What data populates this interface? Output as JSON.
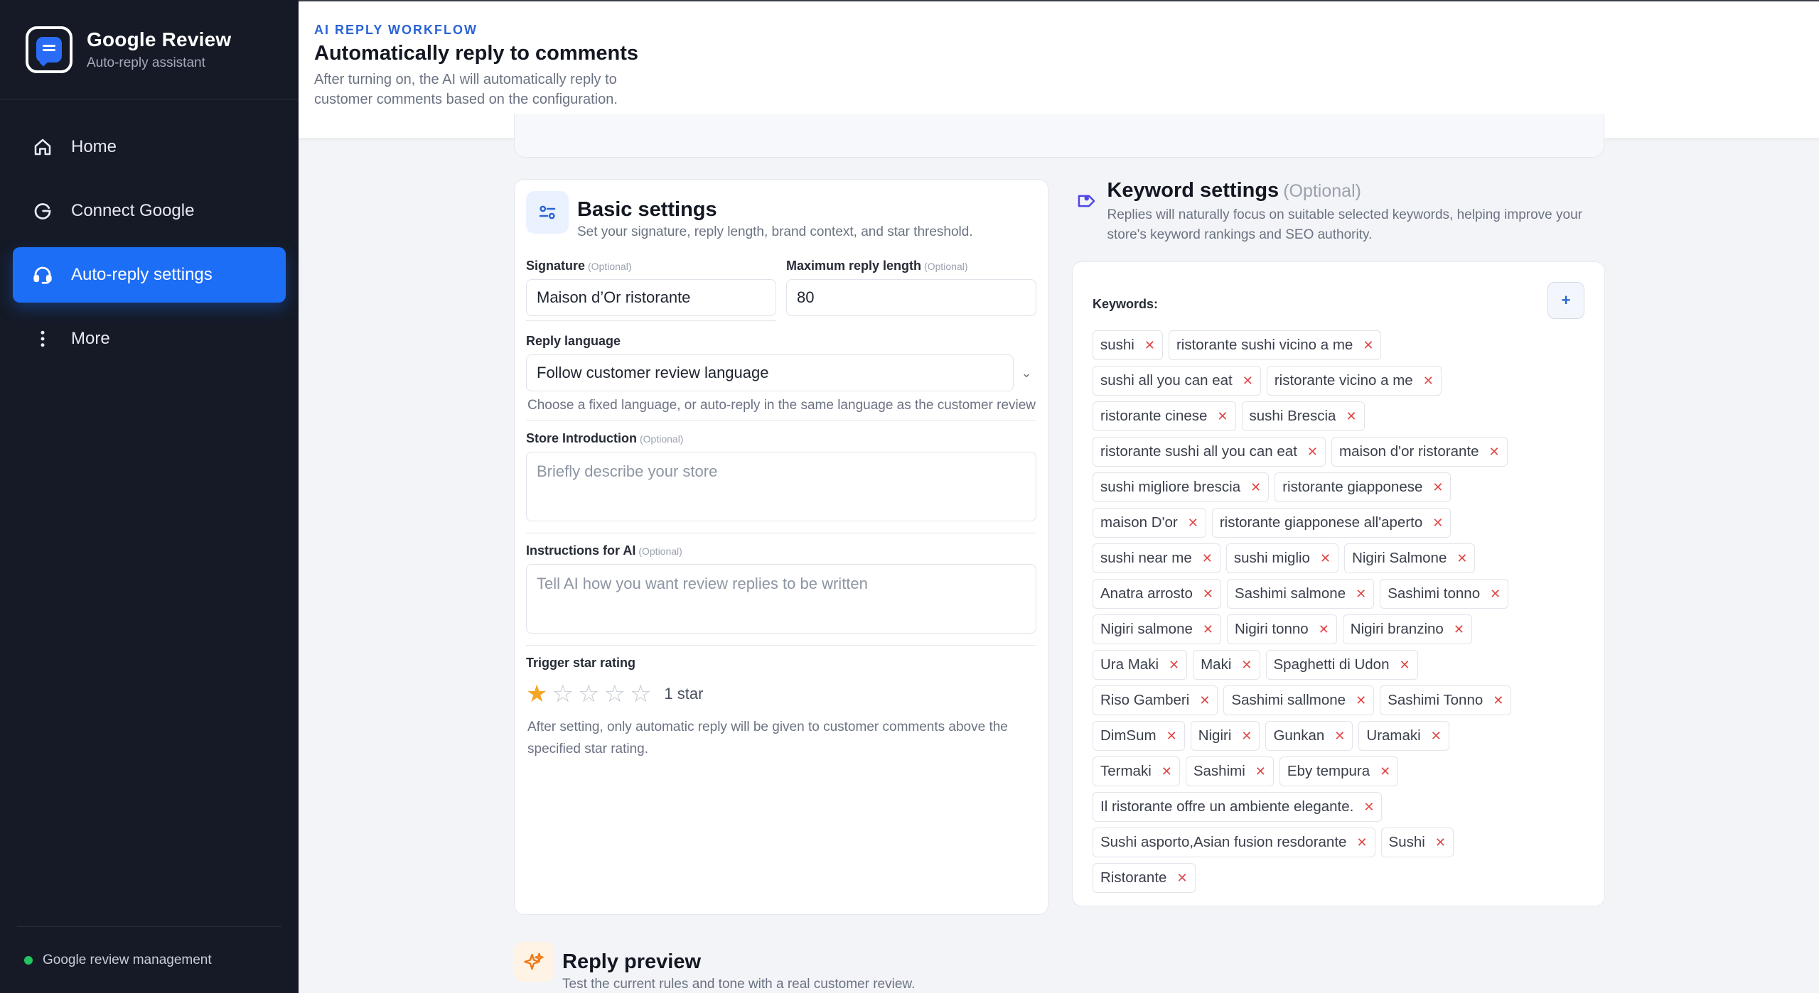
{
  "brand": {
    "title": "Google Review",
    "subtitle": "Auto-reply assistant"
  },
  "nav": [
    {
      "label": "Home",
      "icon": "home-icon"
    },
    {
      "label": "Connect Google",
      "icon": "google-g-icon"
    },
    {
      "label": "Auto-reply settings",
      "icon": "headset-icon",
      "active": true
    },
    {
      "label": "More",
      "icon": "more-vertical-icon"
    }
  ],
  "footer": {
    "status": "Google review management",
    "status_color": "#22c55e"
  },
  "header": {
    "kicker": "AI REPLY WORKFLOW",
    "title": "Automatically reply to comments",
    "description": "After turning on, the AI will automatically reply to customer comments based on the configuration."
  },
  "basic": {
    "title": "Basic settings",
    "subtitle": "Set your signature, reply length, brand context, and star threshold.",
    "signature_label": "Signature",
    "optional": "(Optional)",
    "signature_value": "Maison d’Or ristorante",
    "max_length_label": "Maximum reply length",
    "max_length_value": "80",
    "language_label": "Reply language",
    "language_value": "Follow customer review language",
    "language_help": "Choose a fixed language, or auto-reply in the same language as the customer review",
    "intro_label": "Store Introduction",
    "intro_placeholder": "Briefly describe your store",
    "instructions_label": "Instructions for AI",
    "instructions_placeholder": "Tell AI how you want review replies to be written",
    "trigger_label": "Trigger star rating",
    "stars_selected": 1,
    "stars_total": 5,
    "star_text": "1 star",
    "trigger_help": "After setting, only automatic reply will be given to customer comments above the specified star rating."
  },
  "keywords": {
    "title": "Keyword settings",
    "optional": "(Optional)",
    "description": "Replies will naturally focus on suitable selected keywords, helping improve your store's keyword rankings and SEO authority.",
    "label": "Keywords:",
    "add_label": "+",
    "remove_symbol": "✕",
    "items": [
      "sushi",
      "ristorante sushi vicino a me",
      "sushi all you can eat",
      "ristorante vicino a me",
      "ristorante cinese",
      "sushi Brescia",
      "ristorante sushi all you can eat",
      "maison d'or ristorante",
      "sushi migliore brescia",
      "ristorante giapponese",
      "maison D'or",
      "ristorante giapponese all'aperto",
      "sushi near me",
      "sushi miglio",
      "Nigiri Salmone",
      "Anatra arrosto",
      "Sashimi salmone",
      "Sashimi tonno",
      "Nigiri salmone",
      "Nigiri tonno",
      "Nigiri branzino",
      "Ura Maki",
      "Maki",
      "Spaghetti di Udon",
      "Riso Gamberi",
      "Sashimi sallmone",
      "Sashimi Tonno",
      "DimSum",
      "Nigiri",
      "Gunkan",
      "Uramaki",
      "Termaki",
      "Sashimi",
      "Eby tempura",
      "Il ristorante offre un ambiente elegante.",
      "Sushi asporto,Asian fusion resdorante",
      "Sushi",
      "Ristorante"
    ]
  },
  "preview": {
    "title": "Reply preview",
    "subtitle": "Test the current rules and tone with a real customer review."
  },
  "colors": {
    "accent": "#1d6ef7",
    "sidebar": "#151a26",
    "star": "#f5a623",
    "remove": "#e04848"
  }
}
